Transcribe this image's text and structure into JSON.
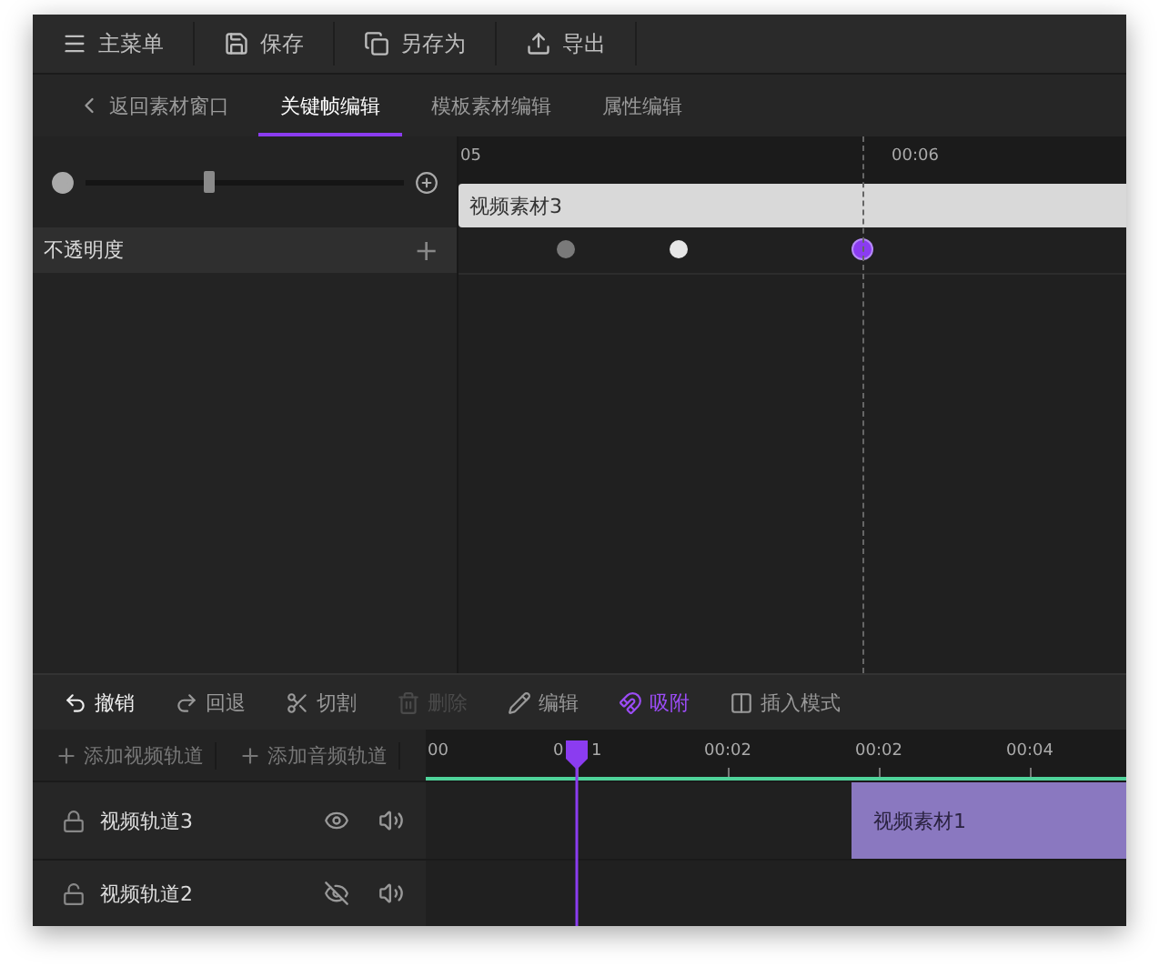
{
  "menu": [
    {
      "kind": "menu",
      "label": "主菜单"
    },
    {
      "kind": "save",
      "label": "保存"
    },
    {
      "kind": "saveas",
      "label": "另存为"
    },
    {
      "kind": "export",
      "label": "导出"
    }
  ],
  "tabs": [
    {
      "kind": "back",
      "label": "返回素材窗口",
      "selected": false
    },
    {
      "kind": "tab",
      "label": "关键帧编辑",
      "selected": true
    },
    {
      "kind": "tab",
      "label": "模板素材编辑",
      "selected": false
    },
    {
      "kind": "tab",
      "label": "属性编辑",
      "selected": false
    }
  ],
  "zoom": {
    "level": 0.37
  },
  "property": {
    "label": "不透明度",
    "add": "+"
  },
  "keyframe_ruler": [
    "05",
    "00:06"
  ],
  "keyframe_clip": "视频素材3",
  "keyframes": [
    {
      "color": "#7a7a7a",
      "selected": false
    },
    {
      "color": "#e6e6e6",
      "selected": false
    },
    {
      "color": "#8b3cf0",
      "selected": true
    }
  ],
  "tools": [
    {
      "kind": "undo",
      "label": "撤销",
      "disabled": false,
      "active": false
    },
    {
      "kind": "redo",
      "label": "回退",
      "disabled": false,
      "active": false
    },
    {
      "kind": "cut",
      "label": "切割",
      "disabled": false,
      "active": false
    },
    {
      "kind": "delete",
      "label": "删除",
      "disabled": true,
      "active": false
    },
    {
      "kind": "edit",
      "label": "编辑",
      "disabled": false,
      "active": false
    },
    {
      "kind": "snap",
      "label": "吸附",
      "disabled": false,
      "active": true
    },
    {
      "kind": "insert",
      "label": "插入模式",
      "disabled": false,
      "active": false
    }
  ],
  "add_buttons": [
    "添加视频轨道",
    "添加音频轨道"
  ],
  "timeline_ruler": [
    {
      "label": "00"
    },
    {
      "label": "0",
      "after": "1"
    },
    {
      "label": "00:02"
    },
    {
      "label": "00:02"
    },
    {
      "label": "00:04"
    }
  ],
  "tracks": [
    {
      "name": "视频轨道3",
      "locked": true,
      "visible": true,
      "clip": "视频素材1"
    },
    {
      "name": "视频轨道2",
      "locked": false,
      "visible": false
    }
  ]
}
